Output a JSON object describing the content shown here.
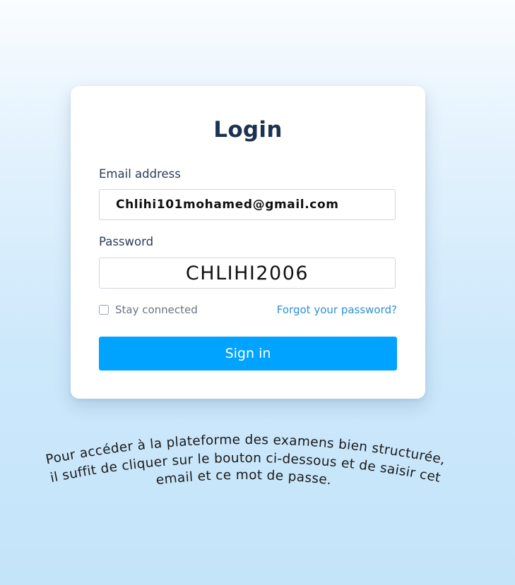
{
  "login": {
    "title": "Login",
    "email_label": "Email address",
    "email_value": "Chlihi101mohamed@gmail.com",
    "password_label": "Password",
    "password_value": "CHLIHI2006",
    "stay_connected_label": "Stay connected",
    "stay_connected_checked": false,
    "forgot_password_link": "Forgot your password?",
    "sign_in_button": "Sign in"
  },
  "caption": {
    "line1": "Pour accéder à la plateforme des examens bien structurée,",
    "line2": "il suffit de cliquer sur le bouton ci-dessous et de saisir cet",
    "line3": "email et ce mot de passe."
  },
  "colors": {
    "title": "#1c3252",
    "link": "#2d8fd5",
    "button": "#00a3ff",
    "background": "#cde8fb"
  }
}
